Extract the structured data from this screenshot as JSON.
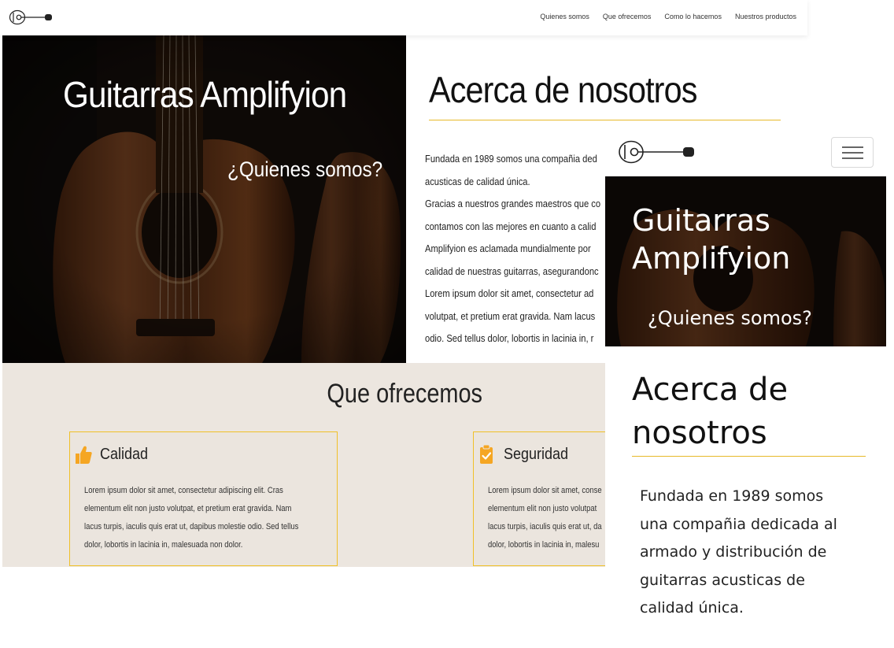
{
  "desktop": {
    "nav": {
      "logo_icon": "guitar-logo-icon",
      "links": [
        "Quienes somos",
        "Que ofrecemos",
        "Como lo hacemos",
        "Nuestros productos"
      ]
    },
    "hero": {
      "title": "Guitarras Amplifyion",
      "subtitle": "¿Quienes somos?",
      "background": "acoustic-guitar-photo"
    },
    "about": {
      "title": "Acerca de nosotros",
      "lines": [
        "Fundada en 1989 somos una compañia ded",
        "acusticas de calidad única.",
        "Gracias a nuestros grandes maestros que co",
        "contamos con las mejores en cuanto a calid",
        "Amplifyion es aclamada mundialmente por",
        "calidad de nuestras guitarras, asegurandonc",
        "Lorem ipsum dolor sit amet, consectetur ad",
        "volutpat, et pretium erat gravida. Nam lacus",
        "odio. Sed tellus dolor, lobortis in lacinia in, r"
      ]
    },
    "offer": {
      "title": "Que ofrecemos",
      "cards": [
        {
          "icon": "thumbs-up-icon",
          "title": "Calidad",
          "lines": [
            "Lorem ipsum dolor sit amet, consectetur adipiscing elit. Cras",
            "elementum elit non justo volutpat, et pretium erat gravida. Nam",
            "lacus turpis, iaculis quis erat ut, dapibus molestie odio. Sed tellus",
            "dolor, lobortis in lacinia in, malesuada non dolor."
          ]
        },
        {
          "icon": "clipboard-check-icon",
          "title": "Seguridad",
          "lines": [
            "Lorem ipsum dolor sit amet, conse",
            "elementum elit non justo volutpat",
            "lacus turpis, iaculis quis erat ut, da",
            "dolor, lobortis in lacinia in, malesu"
          ]
        }
      ]
    }
  },
  "mobile": {
    "logo_icon": "guitar-logo-icon",
    "menu_icon": "hamburger-menu-icon",
    "hero": {
      "title": "Guitarras Amplifyion",
      "subtitle": "¿Quienes somos?"
    },
    "about": {
      "title": "Acerca de nosotros",
      "lines": [
        "Fundada en 1989 somos",
        "una compañia dedicada al",
        "armado y distribución de",
        "guitarras acusticas de",
        "calidad única."
      ]
    }
  },
  "colors": {
    "accent": "#f0c028",
    "offer_bg": "#ece6df",
    "icon": "#f5a623"
  }
}
